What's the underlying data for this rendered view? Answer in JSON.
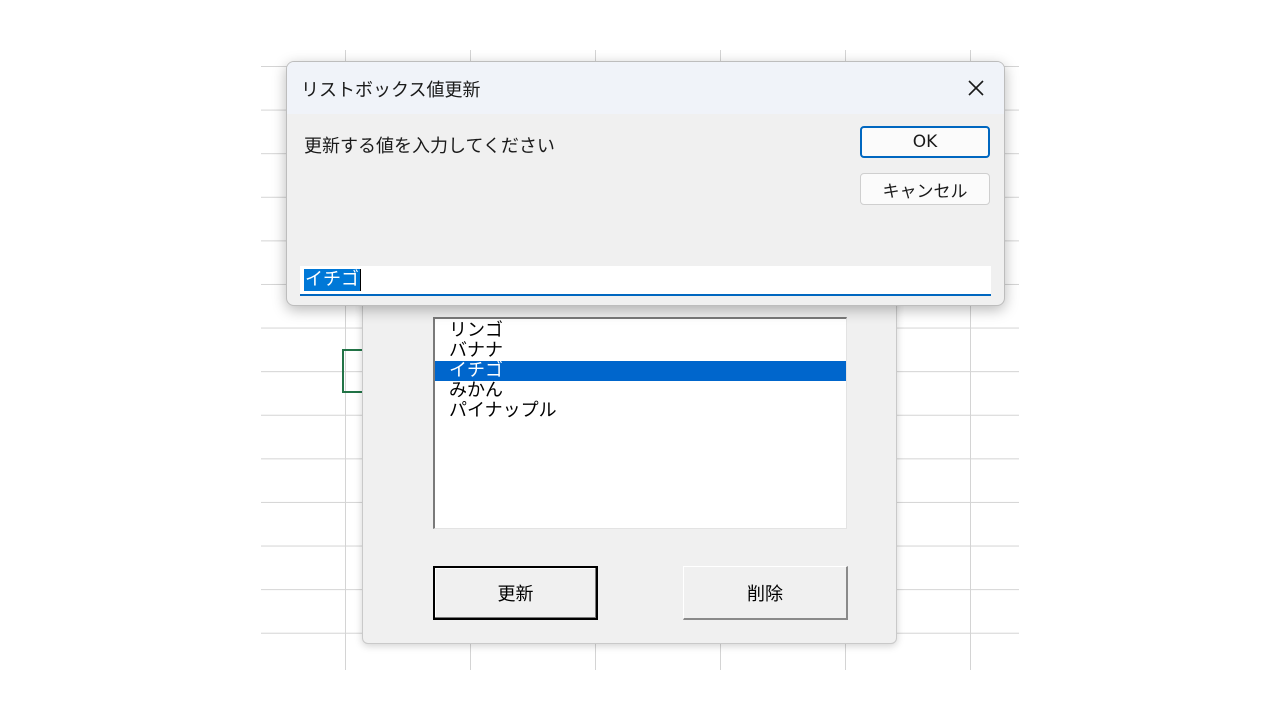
{
  "dialog": {
    "title": "リストボックス値更新",
    "prompt": "更新する値を入力してください",
    "ok_label": "OK",
    "cancel_label": "キャンセル",
    "input_value": "イチゴ",
    "close_icon": "close-icon"
  },
  "userform": {
    "list_items": [
      {
        "label": "リンゴ",
        "selected": false
      },
      {
        "label": "バナナ",
        "selected": false
      },
      {
        "label": "イチゴ",
        "selected": true
      },
      {
        "label": "みかん",
        "selected": false
      },
      {
        "label": "パイナップル",
        "selected": false
      }
    ],
    "update_label": "更新",
    "delete_label": "削除"
  },
  "colors": {
    "selection": "#0066cc",
    "accent": "#0067c0",
    "excel_active_cell": "#217346"
  }
}
